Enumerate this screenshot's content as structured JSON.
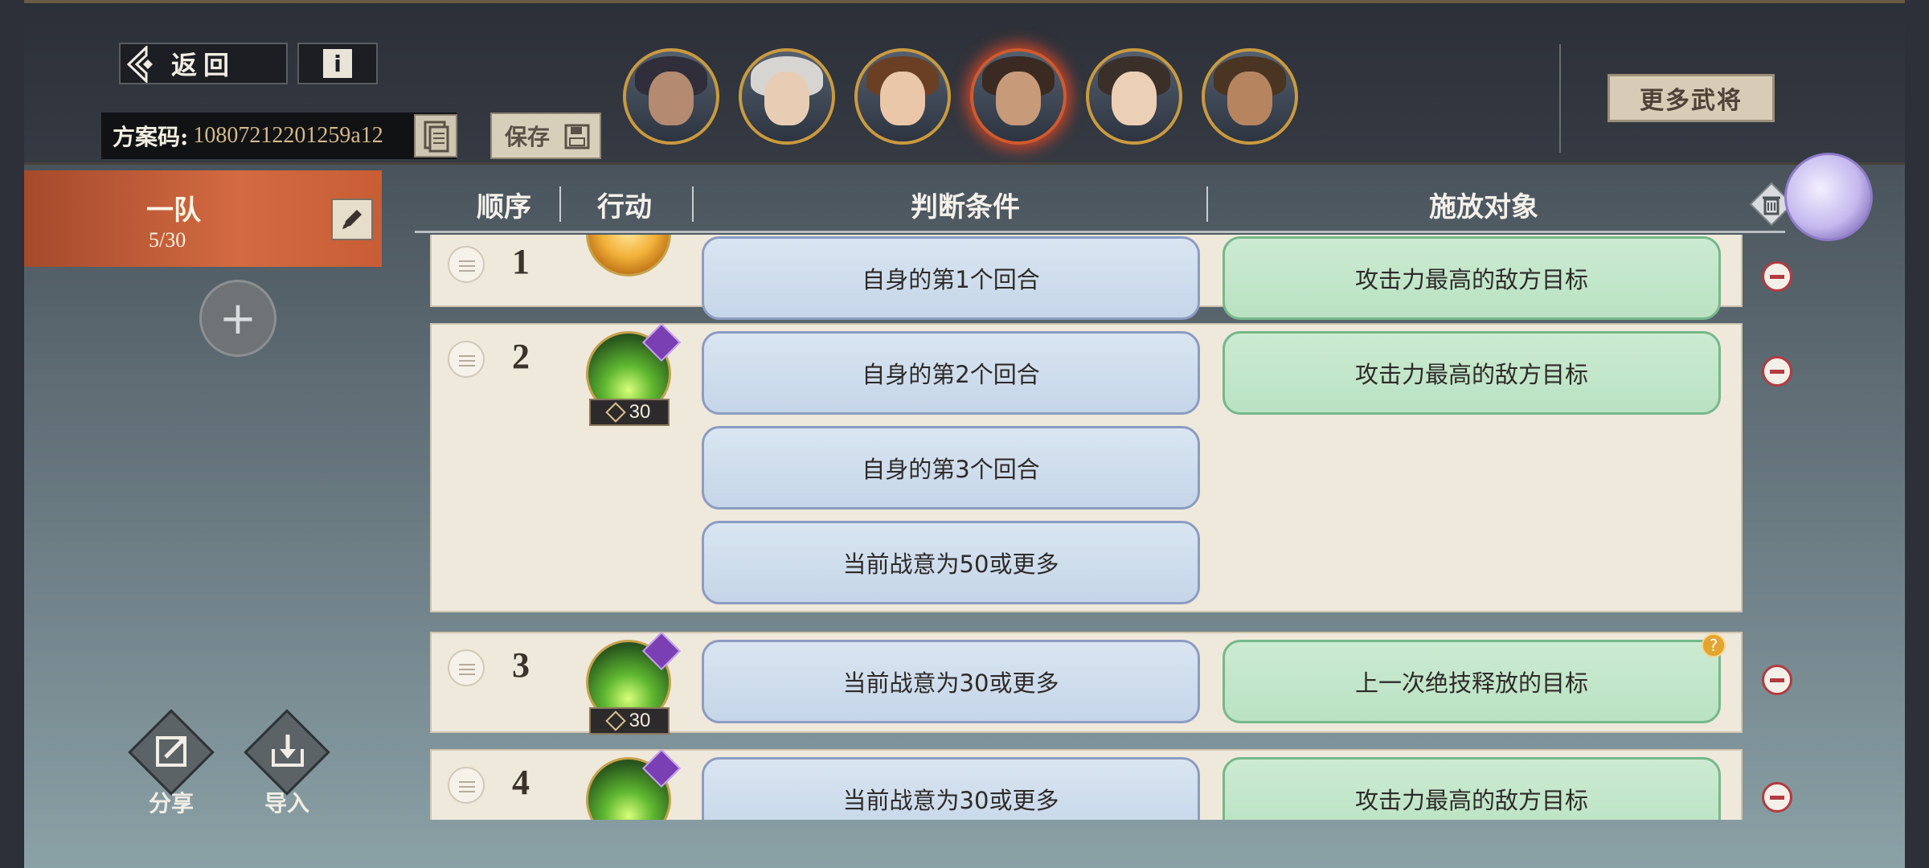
{
  "header": {
    "back_label": "返回",
    "info_label": "i",
    "plan_code_label": "方案码:",
    "plan_code_value": "10807212201259a12",
    "save_label": "保存",
    "more_generals_label": "更多武将"
  },
  "generals": [
    {
      "name": "general-1",
      "hair": "#2f2e3a",
      "skin": "#b48a70"
    },
    {
      "name": "general-2",
      "hair": "#d7d5d2",
      "skin": "#e8cdb4"
    },
    {
      "name": "general-3",
      "hair": "#6a3f24",
      "skin": "#eac7a8"
    },
    {
      "name": "general-4",
      "hair": "#3a2a22",
      "skin": "#c79a7a"
    },
    {
      "name": "general-5",
      "hair": "#3b2f2a",
      "skin": "#ecd0b6"
    },
    {
      "name": "general-6",
      "hair": "#4a3422",
      "skin": "#b68560"
    }
  ],
  "active_general_index": 3,
  "team": {
    "name": "一队",
    "count": "5/30"
  },
  "sidebar": {
    "share_label": "分享",
    "import_label": "导入"
  },
  "table": {
    "headers": {
      "order": "顺序",
      "action": "行动",
      "condition": "判断条件",
      "target": "施放对象"
    },
    "rows": [
      {
        "order": "1",
        "skill": "basic-attack",
        "cost": "",
        "conditions": [
          "自身的第1个回合"
        ],
        "target": "攻击力最高的敌方目标",
        "target_help": false
      },
      {
        "order": "2",
        "skill": "special-skill",
        "cost": "30",
        "conditions": [
          "自身的第2个回合",
          "自身的第3个回合",
          "当前战意为50或更多"
        ],
        "target": "攻击力最高的敌方目标",
        "target_help": false
      },
      {
        "order": "3",
        "skill": "special-skill",
        "cost": "30",
        "conditions": [
          "当前战意为30或更多"
        ],
        "target": "上一次绝技释放的目标",
        "target_help": true
      },
      {
        "order": "4",
        "skill": "special-skill",
        "cost": "",
        "conditions": [
          "当前战意为30或更多"
        ],
        "target": "攻击力最高的敌方目标",
        "target_help": false
      }
    ]
  },
  "colors": {
    "team_tab": "#d36a41",
    "condition_fill": "#c5d6e8",
    "target_fill": "#b9e2c2",
    "remove_red": "#b33a3f"
  }
}
